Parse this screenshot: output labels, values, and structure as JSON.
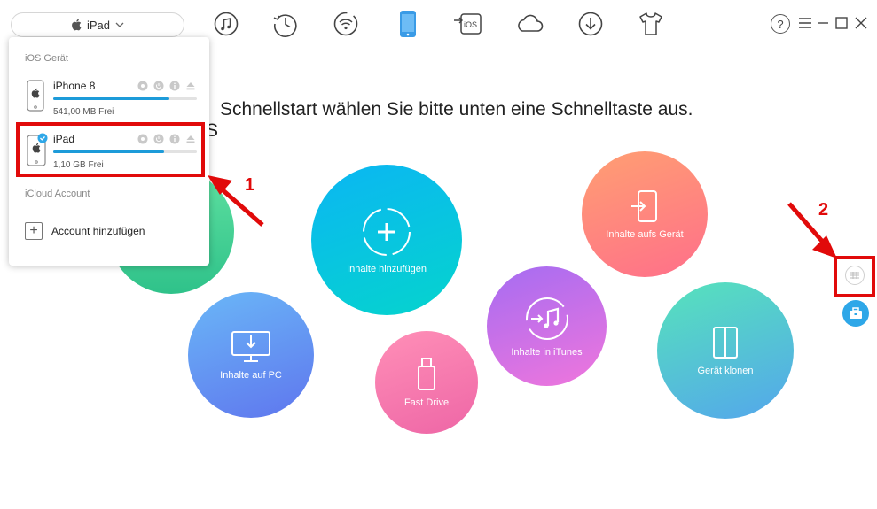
{
  "toolbar": {
    "device_select": "iPad",
    "icons": [
      "music-icon",
      "history-icon",
      "wifi-sync-icon",
      "device-icon",
      "ios-transfer-icon",
      "cloud-icon",
      "download-icon",
      "tshirt-icon"
    ]
  },
  "window": {
    "help": "?"
  },
  "main": {
    "heading": "Schnellstart wählen Sie bitte unten eine Schnelltaste aus.",
    "heading_tail": "S",
    "shortcuts": [
      {
        "label": "Inhalte hinzufügen",
        "icon": "add-content-icon",
        "colors": [
          "#0bb6f3",
          "#05d4cd"
        ]
      },
      {
        "label": "Inhalte aufs Gerät",
        "icon": "to-device-icon",
        "colors": [
          "#ff9f72",
          "#ff6f8a"
        ]
      },
      {
        "label": "Inhalte auf PC",
        "icon": "to-pc-icon",
        "colors": [
          "#6ab7f7",
          "#5f76ee"
        ]
      },
      {
        "label": "Inhalte in iTunes",
        "icon": "to-itunes-icon",
        "colors": [
          "#a56cf2",
          "#f076dc"
        ]
      },
      {
        "label": "Fast Drive",
        "icon": "usb-drive-icon",
        "colors": [
          "#ff8fb7",
          "#ee66a6"
        ]
      },
      {
        "label": "Gerät klonen",
        "icon": "clone-device-icon",
        "colors": [
          "#56e3bb",
          "#54a6ec"
        ]
      }
    ]
  },
  "dropdown": {
    "section_ios": "iOS Gerät",
    "devices": [
      {
        "name": "iPhone 8",
        "free": "541,00 MB Frei",
        "used_fraction": 0.81
      },
      {
        "name": "iPad",
        "free": "1,10 GB Frei",
        "used_fraction": 0.77
      }
    ],
    "section_icloud": "iCloud Account",
    "add_account": "Account hinzufügen"
  },
  "annotations": {
    "marker_1": "1",
    "marker_2": "2"
  },
  "colors": {
    "accent": "#1d9bd9",
    "highlight": "#e10a0a",
    "green_circle": "#3fcc8f"
  }
}
